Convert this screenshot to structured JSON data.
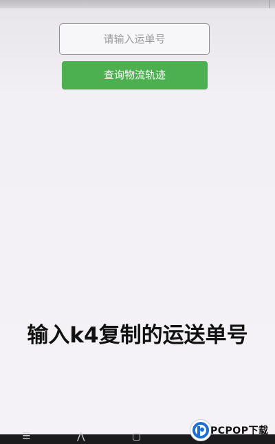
{
  "form": {
    "tracking_placeholder": "请输入运单号",
    "tracking_value": "",
    "query_button_label": "查询物流轨迹"
  },
  "caption": {
    "text": "输入k4复制的运送单号"
  },
  "watermark": {
    "text": "PCPOP下载"
  },
  "colors": {
    "button_green": "#4caf50",
    "background": "#f3f1f5",
    "nav_bar": "#1b1b1e"
  },
  "icons": {
    "nav_menu": "menu-icon",
    "nav_back": "back-icon",
    "nav_home": "home-icon",
    "nav_recent": "recent-apps-icon",
    "watermark_logo": "pcpop-logo-icon"
  }
}
